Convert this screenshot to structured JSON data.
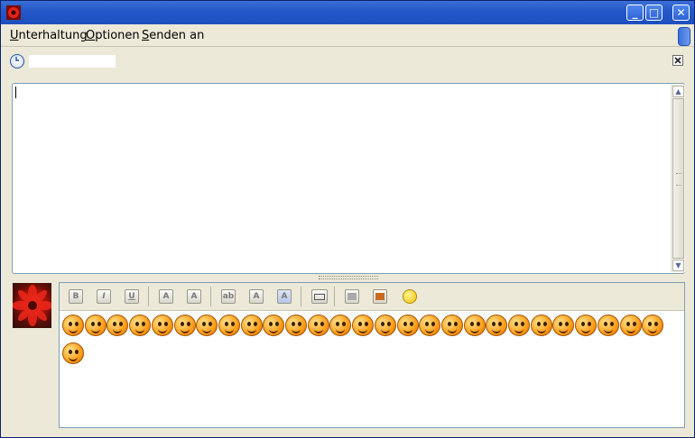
{
  "window": {
    "title": "",
    "controls": {
      "minimize": "_",
      "maximize": "□",
      "close": "✕"
    },
    "accent_color": "#2458c8"
  },
  "menu": {
    "items": [
      {
        "label": "Unterhaltung",
        "accel": "U",
        "rest": "nterhaltung"
      },
      {
        "label": "Optionen",
        "accel": "O",
        "rest": "ptionen"
      },
      {
        "label": "Senden an",
        "accel": "S",
        "rest": "enden an"
      }
    ]
  },
  "conversation": {
    "contact_name": "",
    "status_icon": "status-clock-icon",
    "close_icon": "close-conversation-icon"
  },
  "history": {
    "text": ""
  },
  "format_toolbar": {
    "buttons": [
      {
        "name": "bold-button",
        "glyph": "B"
      },
      {
        "name": "italic-button",
        "glyph": "I"
      },
      {
        "name": "underline-button",
        "glyph": "U"
      },
      {
        "name": "bigger-font-button",
        "glyph": "A"
      },
      {
        "name": "smaller-font-button",
        "glyph": "A"
      },
      {
        "name": "font-face-button",
        "glyph": "ab"
      },
      {
        "name": "foreground-color-button",
        "glyph": "A"
      },
      {
        "name": "background-color-button",
        "glyph": "A"
      },
      {
        "name": "insert-link-button",
        "glyph": ""
      },
      {
        "name": "insert-image-button",
        "glyph": ""
      },
      {
        "name": "insert-picture-button",
        "glyph": ""
      },
      {
        "name": "insert-smiley-button",
        "glyph": ""
      }
    ]
  },
  "emoticons": {
    "count": 27,
    "names": [
      "dizzy-smiley-icon",
      "skull-smiley-icon",
      "globe-smiley-icon",
      "crying-smiley-icon",
      "angry-smiley-icon",
      "grin-smiley-icon",
      "music-smiley-icon",
      "tongue-smiley-icon",
      "cool-smiley-icon",
      "wink-smiley-icon",
      "surprised-smiley-icon",
      "thinking-smiley-icon",
      "mobile-smiley-icon",
      "devil-smiley-icon",
      "kiss-smiley-icon",
      "skull-smiley-icon",
      "mobile-smiley-icon",
      "devil-smiley-icon",
      "angel-smiley-icon",
      "flower-smiley-icon",
      "sick-smiley-icon",
      "bomb-smiley-icon",
      "rage-smiley-icon",
      "thumbs-up-smiley-icon",
      "shout-smiley-icon",
      "dizzy-smiley-icon",
      "laugh-smiley-icon",
      "love-smiley-icon"
    ]
  },
  "compose": {
    "text": ""
  }
}
